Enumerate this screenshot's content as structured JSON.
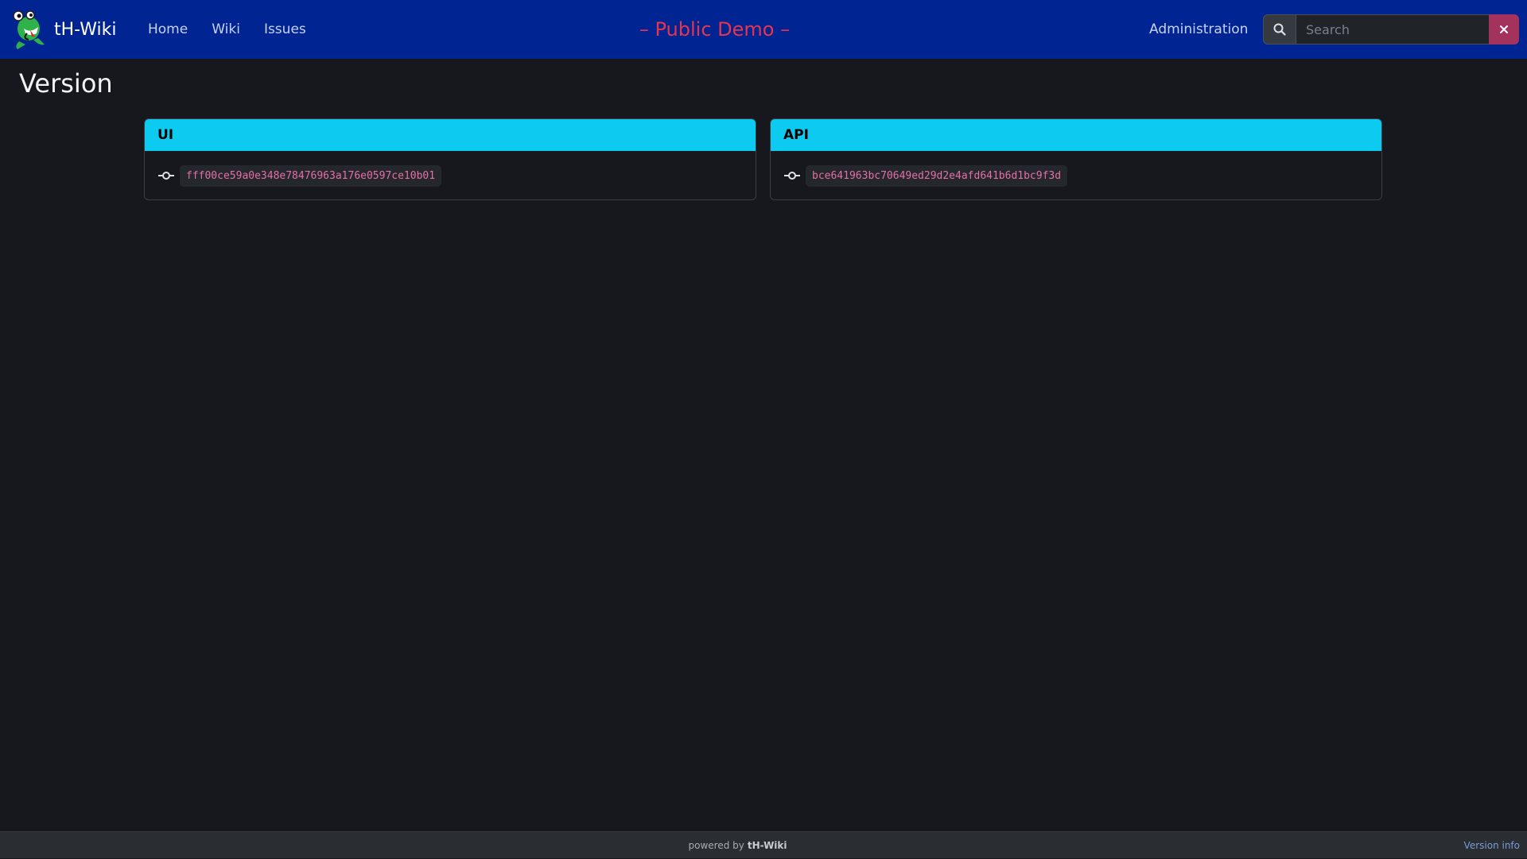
{
  "navbar": {
    "brand": "tH-Wiki",
    "links": [
      "Home",
      "Wiki",
      "Issues"
    ],
    "demo_label": "– Public Demo –",
    "admin_label": "Administration",
    "search_placeholder": "Search",
    "colors": {
      "bar": "#002593",
      "demo": "#e8344e",
      "clear": "#a3325d"
    }
  },
  "page": {
    "title": "Version"
  },
  "cards": [
    {
      "title": "UI",
      "commit": "fff00ce59a0e348e78476963a176e0597ce10b01"
    },
    {
      "title": "API",
      "commit": "bce641963bc70649ed29d2e4afd641b6d1bc9f3d"
    }
  ],
  "icons": {
    "search": "search-icon",
    "clear": "close-icon",
    "commit": "git-commit-icon",
    "logo": "gecko-logo"
  },
  "footer": {
    "powered_by": "powered by",
    "brand": "tH-Wiki",
    "version_link": "Version info"
  },
  "accent_color": "#0dcaf0"
}
